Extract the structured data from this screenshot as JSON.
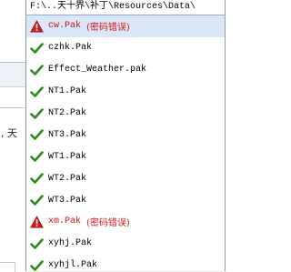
{
  "background": {
    "partial_text": ", 天"
  },
  "dropdown": {
    "path": "F:\\..天十界\\补丁\\Resources\\Data\\",
    "error_label": "(密码错误)",
    "items": [
      {
        "name": "cw.Pak",
        "status": "error",
        "icon": "warning-icon",
        "highlight": true
      },
      {
        "name": "czhk.Pak",
        "status": "ok",
        "icon": "check-icon"
      },
      {
        "name": "Effect_Weather.pak",
        "status": "ok",
        "icon": "check-icon"
      },
      {
        "name": "NT1.Pak",
        "status": "ok",
        "icon": "check-icon"
      },
      {
        "name": "NT2.Pak",
        "status": "ok",
        "icon": "check-icon"
      },
      {
        "name": "NT3.Pak",
        "status": "ok",
        "icon": "check-icon"
      },
      {
        "name": "WT1.Pak",
        "status": "ok",
        "icon": "check-icon"
      },
      {
        "name": "WT2.Pak",
        "status": "ok",
        "icon": "check-icon"
      },
      {
        "name": "WT3.Pak",
        "status": "ok",
        "icon": "check-icon"
      },
      {
        "name": "xm.Pak",
        "status": "error",
        "icon": "warning-icon"
      },
      {
        "name": "xyhj.Pak",
        "status": "ok",
        "icon": "check-icon"
      },
      {
        "name": "xyhjl.Pak",
        "status": "ok",
        "icon": "check-icon"
      }
    ]
  },
  "colors": {
    "check_green": "#2e8b1e",
    "warning_red": "#d11a1a",
    "highlight": "#dbe6f6",
    "border": "#8e9bb0"
  }
}
